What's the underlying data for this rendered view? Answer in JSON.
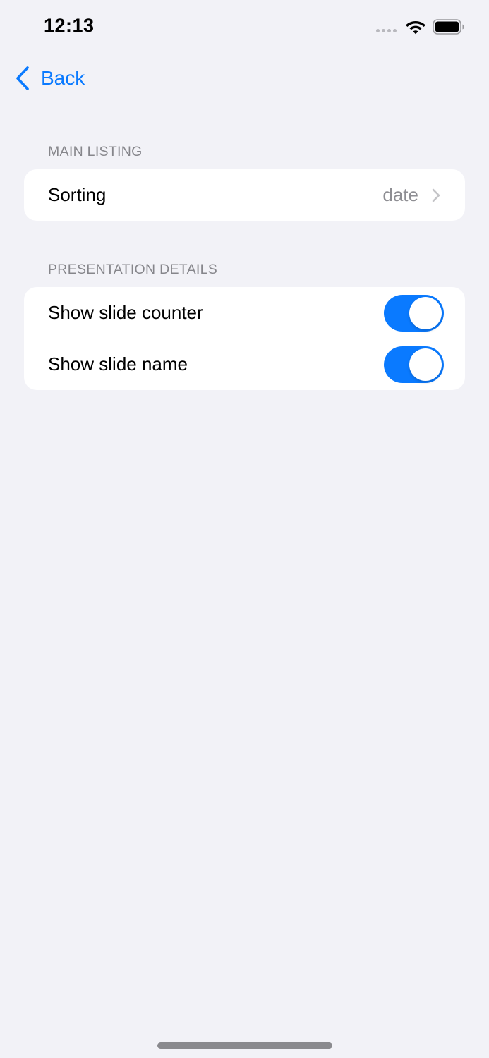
{
  "status_bar": {
    "time": "12:13",
    "icons": [
      "cellular-dots-icon",
      "wifi-icon",
      "battery-icon"
    ]
  },
  "nav": {
    "back_label": "Back",
    "back_icon": "chevron-left-icon"
  },
  "sections": [
    {
      "header": "MAIN LISTING",
      "rows": [
        {
          "label": "Sorting",
          "value": "date",
          "accessory": "chevron-right-icon"
        }
      ]
    },
    {
      "header": "PRESENTATION DETAILS",
      "rows": [
        {
          "label": "Show slide counter",
          "toggle_on": true
        },
        {
          "label": "Show slide name",
          "toggle_on": true
        }
      ]
    }
  ],
  "colors": {
    "accent": "#0a7aff",
    "background": "#f2f2f7",
    "card": "#ffffff",
    "secondary_text": "#8e8e93",
    "section_header": "#86868b"
  }
}
